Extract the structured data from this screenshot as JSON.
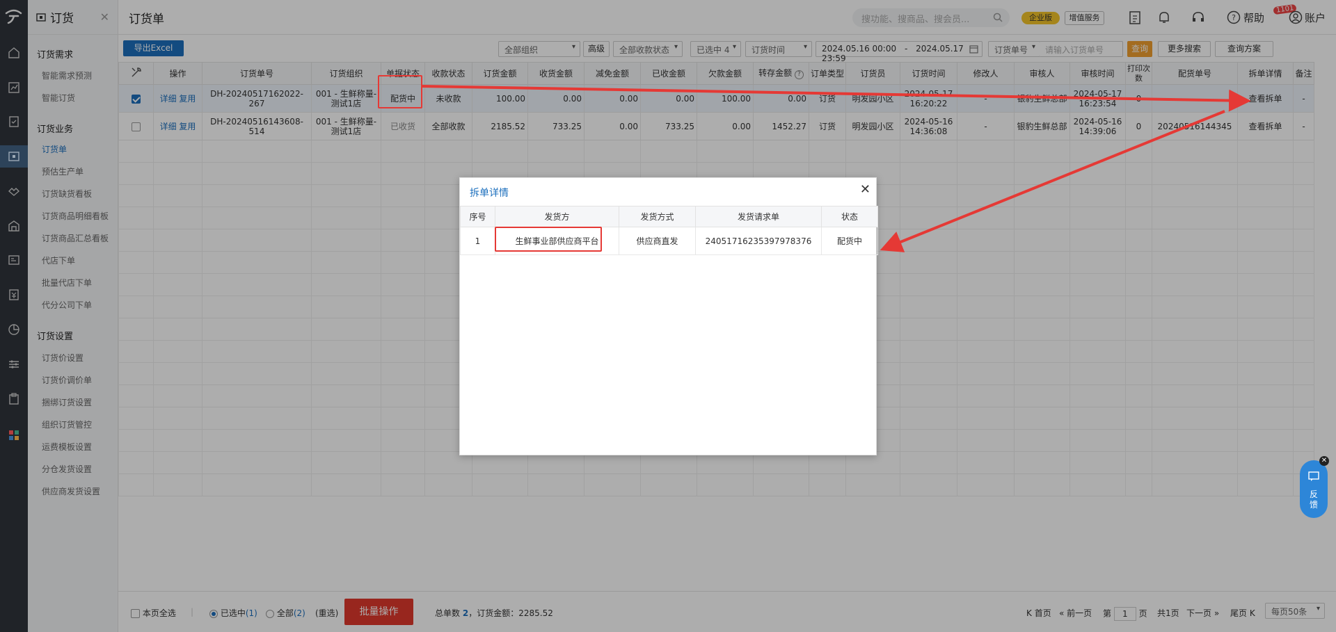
{
  "sidebar": {
    "title": "订货",
    "groups": [
      {
        "label": "订货需求",
        "items": [
          "智能需求预测",
          "智能订货"
        ]
      },
      {
        "label": "订货业务",
        "items": [
          "订货单",
          "预估生产单",
          "订货缺货看板",
          "订货商品明细看板",
          "订货商品汇总看板",
          "代店下单",
          "批量代店下单",
          "代分公司下单"
        ]
      },
      {
        "label": "订货设置",
        "items": [
          "订货价设置",
          "订货价调价单",
          "捆绑订货设置",
          "组织订货管控",
          "运费模板设置",
          "分仓发货设置",
          "供应商发货设置"
        ]
      }
    ],
    "active_item": "订货单"
  },
  "header": {
    "title": "订货单",
    "search_placeholder": "搜功能、搜商品、搜会员...",
    "enterprise_badge": "企业版",
    "value_added": "增值服务",
    "notification_count": "1101",
    "help": "帮助",
    "account": "账户"
  },
  "toolbar": {
    "export": "导出Excel",
    "org_select": "全部组织",
    "advanced": "高级",
    "collect_status": "全部收款状态",
    "selected_status": "已选中 4",
    "time_type": "订货时间",
    "date_start": "2024.05.16 00:00",
    "date_sep": "-",
    "date_end": "2024.05.17 23:59",
    "order_type": "订货单号",
    "order_placeholder": "请输入订货单号",
    "query": "查询",
    "more_search": "更多搜索",
    "query_plan": "查询方案"
  },
  "table": {
    "columns": [
      "操作",
      "订货单号",
      "订货组织",
      "单据状态",
      "收款状态",
      "订货金额",
      "收货金额",
      "减免金额",
      "已收金额",
      "欠款金额",
      "转存金额",
      "订单类型",
      "订货员",
      "订货时间",
      "修改人",
      "审核人",
      "审核时间",
      "打印次数",
      "配货单号",
      "拆单详情",
      "备注"
    ],
    "rows": [
      {
        "selected": true,
        "actions": [
          "详细",
          "复用"
        ],
        "order_no": "DH-20240517162022-267",
        "org": "001 - 生鲜称量-测试1店",
        "status": "配货中",
        "collect": "未收款",
        "amount": "100.00",
        "received": "0.00",
        "discount": "0.00",
        "collected": "0.00",
        "owed": "100.00",
        "transfer": "0.00",
        "type": "订货",
        "clerk": "明发园小区",
        "time": "2024-05-17 16:20:22",
        "modifier": "-",
        "reviewer": "银豹生鲜总部",
        "review_time": "2024-05-17 16:23:54",
        "prints": "0",
        "dist_no": "",
        "split": "查看拆单",
        "remark": "-"
      },
      {
        "selected": false,
        "actions": [
          "详细",
          "复用"
        ],
        "order_no": "DH-20240516143608-514",
        "org": "001 - 生鲜称量-测试1店",
        "status": "已收货",
        "collect": "全部收款",
        "amount": "2185.52",
        "received": "733.25",
        "discount": "0.00",
        "collected": "733.25",
        "owed": "0.00",
        "transfer": "1452.27",
        "type": "订货",
        "clerk": "明发园小区",
        "time": "2024-05-16 14:36:08",
        "modifier": "-",
        "reviewer": "银豹生鲜总部",
        "review_time": "2024-05-16 14:39:06",
        "prints": "0",
        "dist_no": "20240516144345",
        "split": "查看拆单",
        "remark": "-"
      }
    ]
  },
  "footer": {
    "select_page": "本页全选",
    "selected_label": "已选中",
    "selected_count": "(1)",
    "all_label": "全部",
    "all_count": "(2)",
    "reselect": "(重选)",
    "batch": "批量操作",
    "total_label": "总单数",
    "total_count": "2",
    "amount_label": "，订货金额：",
    "amount": "2285.52",
    "first": "首页",
    "prev": "前一页",
    "page_prefix": "第",
    "page": "1",
    "page_suffix": "页",
    "total_pages": "共1页",
    "next": "下一页",
    "last": "尾页",
    "per_page": "每页50条"
  },
  "dialog": {
    "title": "拆单详情",
    "columns": [
      "序号",
      "发货方",
      "发货方式",
      "发货请求单",
      "状态"
    ],
    "rows": [
      {
        "no": "1",
        "shipper": "生鲜事业部供应商平台",
        "method": "供应商直发",
        "request": "240517162353979783​76",
        "status": "配货中"
      }
    ]
  },
  "feedback": {
    "label": "反馈"
  },
  "colors": {
    "primary": "#1c6fbd",
    "danger": "#e0392d",
    "annotation": "#e53935",
    "query": "#f0a030"
  }
}
